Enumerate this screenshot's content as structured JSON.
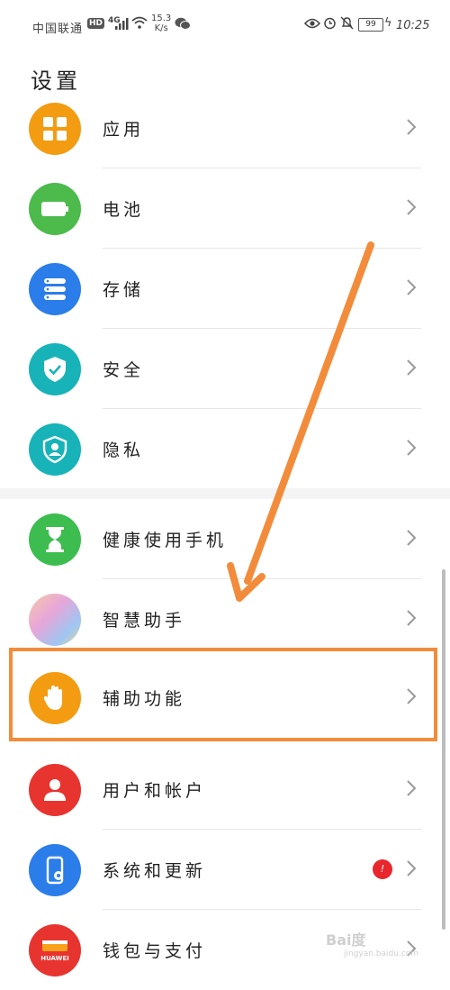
{
  "status_bar": {
    "carrier": "中国联通",
    "hd": "HD",
    "network": "4G",
    "speed_value": "15.3",
    "speed_unit": "K/s",
    "battery": "99",
    "time": "10:25"
  },
  "page": {
    "title": "设置"
  },
  "items": [
    {
      "label": "应用",
      "icon": "apps-grid-icon",
      "color": "#f39c12"
    },
    {
      "label": "电池",
      "icon": "battery-icon",
      "color": "#4cbb4c"
    },
    {
      "label": "存储",
      "icon": "storage-icon",
      "color": "#2b7de9"
    },
    {
      "label": "安全",
      "icon": "shield-icon",
      "color": "#17b3b8"
    },
    {
      "label": "隐私",
      "icon": "privacy-icon",
      "color": "#17b3b8"
    },
    {
      "label": "健康使用手机",
      "icon": "hourglass-icon",
      "color": "#3dbd4f"
    },
    {
      "label": "智慧助手",
      "icon": "smart-assistant-icon",
      "color": "#c9a6e8"
    },
    {
      "label": "辅助功能",
      "icon": "hand-icon",
      "color": "#f39c12"
    },
    {
      "label": "用户和帐户",
      "icon": "user-icon",
      "color": "#e8342f"
    },
    {
      "label": "系统和更新",
      "icon": "system-update-icon",
      "color": "#2b7de9",
      "badge": "!"
    },
    {
      "label": "钱包与支付",
      "icon": "wallet-icon",
      "color": "#e8342f",
      "icon_text": "HUAWEI"
    }
  ],
  "annotation": {
    "color": "#f28c3b"
  },
  "watermark": {
    "text": "Bai度",
    "sub": "jingyan.baidu.com"
  }
}
